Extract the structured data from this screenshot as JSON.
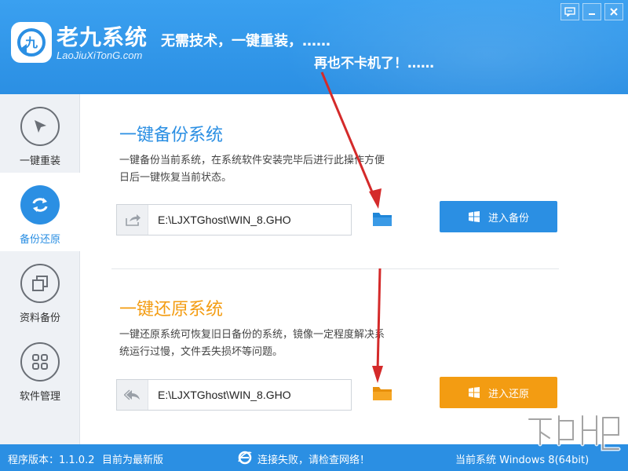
{
  "header": {
    "app_name": "老九系统",
    "app_url": "LaoJiuXiTonG.com",
    "slogan_line1": "无需技术，一键重装，……",
    "slogan_line2": "再也不卡机了！……"
  },
  "window_controls": [
    "chat-icon",
    "minimize-icon",
    "close-icon"
  ],
  "sidebar": {
    "items": [
      {
        "label": "一键重装",
        "icon": "cursor-arrow-icon",
        "active": false
      },
      {
        "label": "备份还原",
        "icon": "refresh-arrows-icon",
        "active": true
      },
      {
        "label": "资料备份",
        "icon": "copy-squares-icon",
        "active": false
      },
      {
        "label": "软件管理",
        "icon": "grid-dots-icon",
        "active": false
      }
    ]
  },
  "backup": {
    "title": "一键备份系统",
    "desc": "一键备份当前系统，在系统软件安装完毕后进行此操作方便日后一键恢复当前状态。",
    "path": "E:\\LJXTGhost\\WIN_8.GHO",
    "button_label": "进入备份",
    "accent": "#2b8fe3"
  },
  "restore": {
    "title": "一键还原系统",
    "desc": "一键还原系统可恢复旧日备份的系统，镜像一定程度解决系统运行过慢，文件丢失损坏等问题。",
    "path": "E:\\LJXTGhost\\WIN_8.GHO",
    "button_label": "进入还原",
    "accent": "#f39c12"
  },
  "status_bar": {
    "version": "程序版本：1.1.0.2",
    "update_status": "目前为最新版",
    "network_status": "连接失败，请检查网络！",
    "current_system": "当前系统 Windows 8(64bit)"
  },
  "colors": {
    "header_blue": "#2b8fe3",
    "annotation_red": "#d42a2a",
    "folder_blue": "#1f86d8",
    "folder_orange": "#f39c12"
  }
}
